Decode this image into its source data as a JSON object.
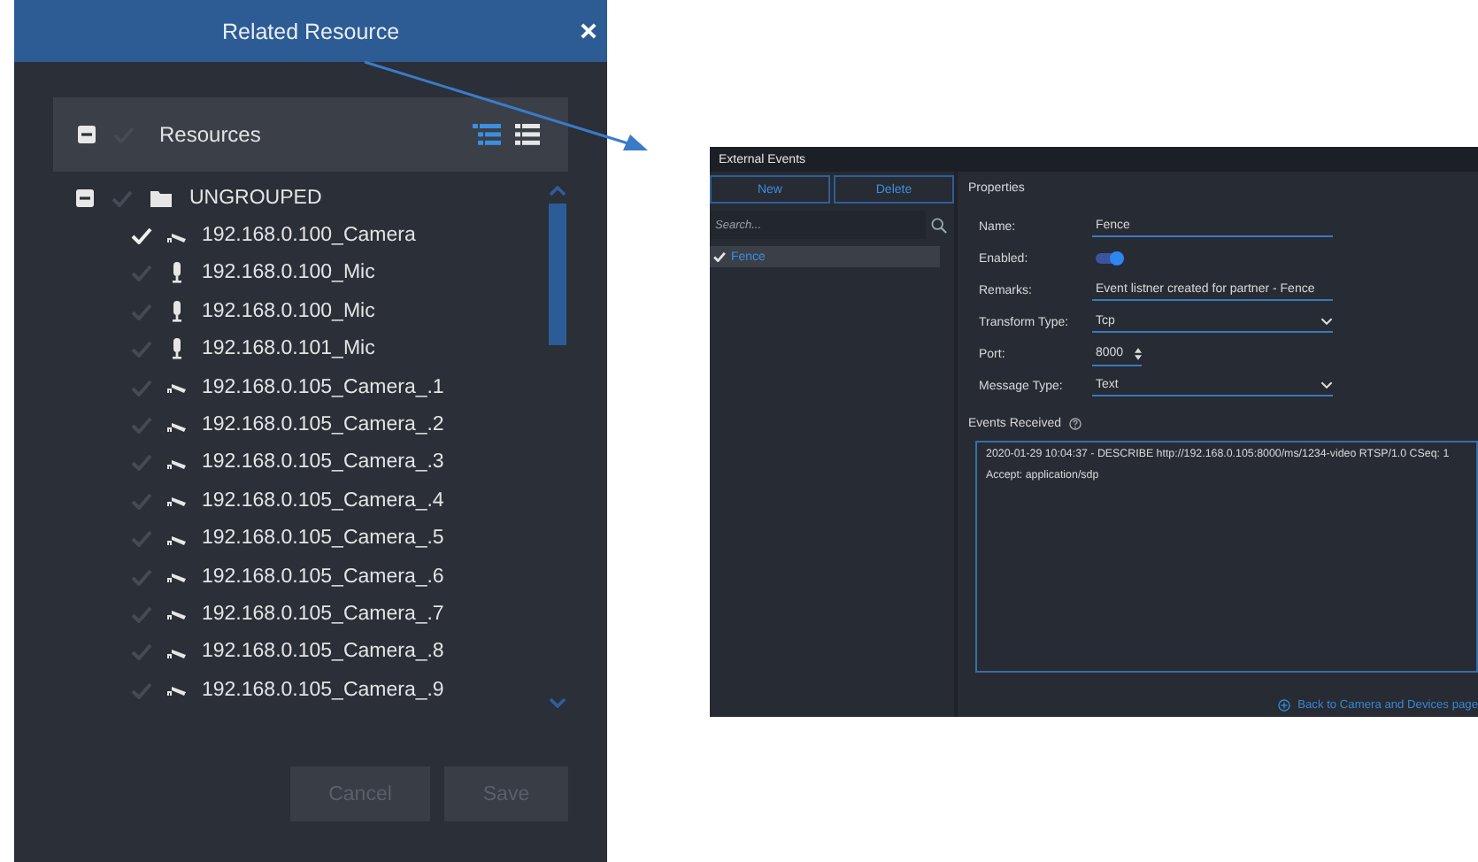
{
  "related_resource_dialog": {
    "title": "Related Resource",
    "header": {
      "label": "Resources",
      "expanded": true,
      "checked": false,
      "view_modes": [
        {
          "kind": "tree",
          "selected": true
        },
        {
          "kind": "list",
          "selected": false
        }
      ]
    },
    "tree": [
      {
        "label": "UNGROUPED",
        "kind": "folder",
        "expanded": true,
        "checked": false,
        "children": [
          {
            "kind": "camera",
            "label": "192.168.0.100_Camera",
            "checked": true
          },
          {
            "kind": "mic",
            "label": "192.168.0.100_Mic",
            "checked": false
          },
          {
            "kind": "mic",
            "label": "192.168.0.100_Mic",
            "checked": false
          },
          {
            "kind": "mic",
            "label": "192.168.0.101_Mic",
            "checked": false
          },
          {
            "kind": "camera",
            "label": "192.168.0.105_Camera_.1",
            "checked": false
          },
          {
            "kind": "camera",
            "label": "192.168.0.105_Camera_.2",
            "checked": false
          },
          {
            "kind": "camera",
            "label": "192.168.0.105_Camera_.3",
            "checked": false
          },
          {
            "kind": "camera",
            "label": "192.168.0.105_Camera_.4",
            "checked": false
          },
          {
            "kind": "camera",
            "label": "192.168.0.105_Camera_.5",
            "checked": false
          },
          {
            "kind": "camera",
            "label": "192.168.0.105_Camera_.6",
            "checked": false
          },
          {
            "kind": "camera",
            "label": "192.168.0.105_Camera_.7",
            "checked": false
          },
          {
            "kind": "camera",
            "label": "192.168.0.105_Camera_.8",
            "checked": false
          },
          {
            "kind": "camera",
            "label": "192.168.0.105_Camera_.9",
            "checked": false
          }
        ]
      }
    ],
    "buttons": [
      {
        "label": "Cancel",
        "disabled": true
      },
      {
        "label": "Save",
        "disabled": true
      }
    ]
  },
  "external_events": {
    "title": "External Events",
    "buttons": [
      {
        "label": "New"
      },
      {
        "label": "Delete"
      }
    ],
    "search": {
      "placeholder": "Search..."
    },
    "items": [
      {
        "label": "Fence",
        "selected": true,
        "checked": true
      }
    ],
    "properties": {
      "title": "Properties",
      "fields": [
        {
          "kind": "text",
          "label": "Name:",
          "value": "Fence"
        },
        {
          "kind": "toggle",
          "label": "Enabled:",
          "on": true
        },
        {
          "kind": "text",
          "label": "Remarks:",
          "value": "Event listner created for partner - Fence"
        },
        {
          "kind": "select",
          "label": "Transform Type:",
          "value": "Tcp"
        },
        {
          "kind": "spinner",
          "label": "Port:",
          "value": "8000"
        },
        {
          "kind": "select",
          "label": "Message Type:",
          "value": "Text"
        }
      ]
    },
    "events_received": {
      "label": "Events Received",
      "lines": [
        "2020-01-29 10:04:37 - DESCRIBE http://192.168.0.105:8000/ms/1234-video RTSP/1.0 CSeq: 1",
        "Accept: application/sdp"
      ]
    },
    "back_link": "Back to Camera and Devices page"
  }
}
